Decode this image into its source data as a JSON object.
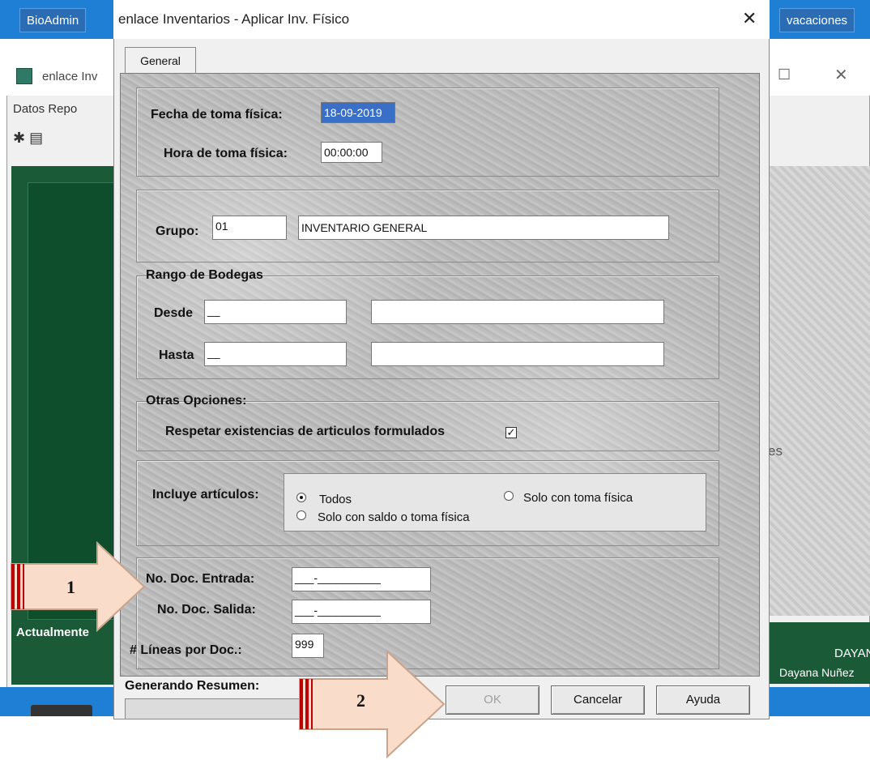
{
  "taskbar": {
    "left_item": "BioAdmin",
    "right_item": "vacaciones"
  },
  "background_window": {
    "title": "enlace Inv",
    "menu": "Datos   Repo",
    "status_label": "Actualmente",
    "right_text": "es",
    "user_short": "DAYANA",
    "user_full": "Dayana Nuñez"
  },
  "dialog": {
    "title": "enlace Inventarios - Aplicar Inv. Físico",
    "close_glyph": "✕",
    "tab_label": "General",
    "fecha": {
      "label": "Fecha de toma física:",
      "value": "18-09-2019"
    },
    "hora": {
      "label": "Hora de toma física:",
      "value": "00:00:00"
    },
    "grupo": {
      "label": "Grupo:",
      "code": "01",
      "name": "INVENTARIO GENERAL"
    },
    "bodegas": {
      "title": "Rango de Bodegas",
      "desde_label": "Desde",
      "desde_value": "__",
      "desde_name": "",
      "hasta_label": "Hasta",
      "hasta_value": "__",
      "hasta_name": ""
    },
    "otras": {
      "title": "Otras Opciones:",
      "respetar_label": "Respetar existencias de articulos formulados",
      "respetar_checked": "✓"
    },
    "incluye": {
      "label": "Incluye artículos:",
      "options": [
        "Todos",
        "Solo con toma física",
        "Solo con saldo o toma física"
      ],
      "selected": "Todos"
    },
    "documentos": {
      "entrada_label": "No. Doc. Entrada:",
      "entrada_value": "___-__________",
      "salida_label": "No. Doc. Salida:",
      "salida_value": "___-__________",
      "lineas_label": "# Líneas por Doc.:",
      "lineas_value": "999"
    },
    "status_label": "Generando Resumen:",
    "buttons": {
      "ok": "OK",
      "cancel": "Cancelar",
      "help": "Ayuda"
    }
  },
  "annotations": {
    "arrow1": "1",
    "arrow2": "2",
    "fill_color": "#f9dcc9",
    "stripe_color": "#c00000"
  }
}
